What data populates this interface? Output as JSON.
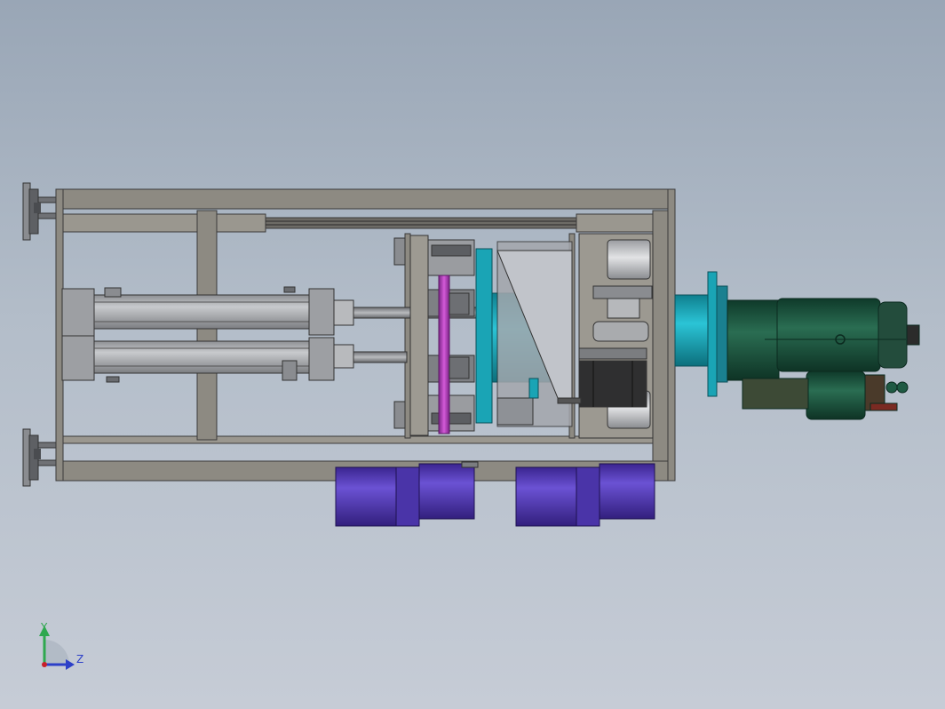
{
  "viewport": {
    "background_top": "#99a6b6",
    "background_bottom": "#c6ccd6"
  },
  "triad": {
    "y_axis_label": "Y",
    "z_axis_label": "Z",
    "y_axis_color": "#2fa84f",
    "z_axis_color": "#2c3fc8",
    "origin_color": "#c8202a"
  },
  "colors": {
    "frame": "#8d8a82",
    "frame_edge": "#3a3a3a",
    "cylinder": "#a7a9ad",
    "teal": "#1aa4b5",
    "purple_motor": "#5a3fc0",
    "magenta_rod": "#b040b8",
    "green_motor": "#1f5a43"
  }
}
